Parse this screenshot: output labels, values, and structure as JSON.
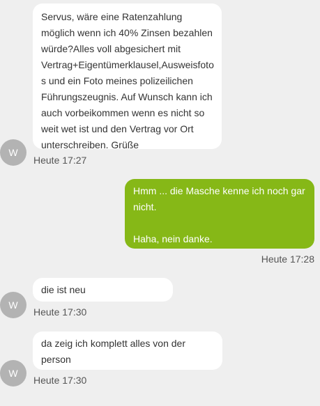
{
  "colors": {
    "background": "#efefef",
    "incoming_bubble": "#ffffff",
    "outgoing_bubble": "#86b817",
    "avatar": "#b3b3b3",
    "text": "#333333",
    "timestamp": "#555555"
  },
  "messages": [
    {
      "direction": "incoming",
      "avatar": "W",
      "lines": [
        "Servus, wäre eine Ratenzahlung",
        "möglich wenn ich 40% Zinsen bezahlen",
        "würde?Alles voll abgesichert mit",
        "Vertrag+Eigentümerklausel,Ausweisfoto",
        "s und ein Foto meines polizeilichen",
        "Führungszeugnis. Auf Wunsch kann ich",
        "auch vorbeikommen wenn es nicht so",
        "weit wet ist und den Vertrag vor Ort",
        "unterschreiben. Grüße"
      ],
      "time": "Heute 17:27"
    },
    {
      "direction": "outgoing",
      "lines": [
        "Hmm ... die Masche kenne ich noch gar",
        "nicht.",
        "",
        "Haha, nein danke."
      ],
      "time": "Heute 17:28"
    },
    {
      "direction": "incoming",
      "avatar": "W",
      "lines": [
        "die ist neu"
      ],
      "time": "Heute 17:30"
    },
    {
      "direction": "incoming",
      "avatar": "W",
      "lines": [
        "da zeig ich komplett alles von der",
        "person"
      ],
      "time": "Heute 17:30"
    }
  ]
}
